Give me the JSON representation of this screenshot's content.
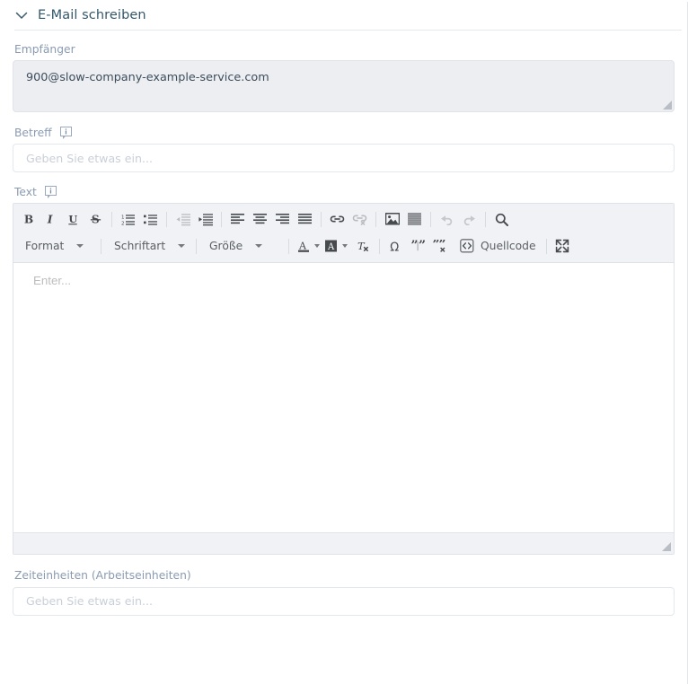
{
  "panel": {
    "title": "E-Mail schreiben",
    "collapse_icon": "chevron-down-icon"
  },
  "fields": {
    "recipient": {
      "label": "Empfänger",
      "value": "900@slow-company-example-service.com"
    },
    "subject": {
      "label": "Betreff",
      "info_icon": "info-tooltip-icon",
      "value": "",
      "placeholder": "Geben Sie etwas ein..."
    },
    "body": {
      "label": "Text",
      "info_icon": "info-tooltip-icon",
      "value": "",
      "placeholder": "Enter..."
    },
    "time_units": {
      "label": "Zeiteinheiten (Arbeitseinheiten)",
      "value": "",
      "placeholder": "Geben Sie etwas ein..."
    }
  },
  "editor_toolbar": {
    "row1": [
      {
        "name": "bold-icon",
        "title": "Fett",
        "disabled": false
      },
      {
        "name": "italic-icon",
        "title": "Kursiv",
        "disabled": false
      },
      {
        "name": "underline-icon",
        "title": "Unterstrichen",
        "disabled": false
      },
      {
        "name": "strikethrough-icon",
        "title": "Durchgestrichen",
        "disabled": false
      },
      {
        "name": "separator",
        "title": "",
        "disabled": false
      },
      {
        "name": "numbered-list-icon",
        "title": "Nummerierte Liste",
        "disabled": false
      },
      {
        "name": "bulleted-list-icon",
        "title": "Aufzählungsliste",
        "disabled": false
      },
      {
        "name": "separator",
        "title": "",
        "disabled": false
      },
      {
        "name": "outdent-icon",
        "title": "Einzug verkleinern",
        "disabled": true
      },
      {
        "name": "indent-icon",
        "title": "Einzug vergrößern",
        "disabled": false
      },
      {
        "name": "separator",
        "title": "",
        "disabled": false
      },
      {
        "name": "align-left-icon",
        "title": "Linksbündig",
        "disabled": false
      },
      {
        "name": "align-center-icon",
        "title": "Zentriert",
        "disabled": false
      },
      {
        "name": "align-right-icon",
        "title": "Rechtsbündig",
        "disabled": false
      },
      {
        "name": "align-justify-icon",
        "title": "Blocksatz",
        "disabled": false
      },
      {
        "name": "separator",
        "title": "",
        "disabled": false
      },
      {
        "name": "link-icon",
        "title": "Link einfügen",
        "disabled": false
      },
      {
        "name": "unlink-icon",
        "title": "Link entfernen",
        "disabled": true
      },
      {
        "name": "separator",
        "title": "",
        "disabled": false
      },
      {
        "name": "image-icon",
        "title": "Bild einfügen",
        "disabled": false
      },
      {
        "name": "horizontal-rule-icon",
        "title": "Horizontale Linie",
        "disabled": false
      },
      {
        "name": "separator",
        "title": "",
        "disabled": false
      },
      {
        "name": "undo-icon",
        "title": "Rückgängig",
        "disabled": true
      },
      {
        "name": "redo-icon",
        "title": "Wiederholen",
        "disabled": true
      },
      {
        "name": "separator",
        "title": "",
        "disabled": false
      },
      {
        "name": "search-icon",
        "title": "Suchen",
        "disabled": false
      }
    ],
    "combos": [
      {
        "name": "format-select",
        "label": "Format"
      },
      {
        "name": "font-select",
        "label": "Schriftart"
      },
      {
        "name": "size-select",
        "label": "Größe"
      }
    ],
    "text_color": {
      "name": "text-color-icon",
      "label": "A"
    },
    "bg_color": {
      "name": "background-color-icon",
      "label": "A"
    },
    "remove_format": {
      "name": "remove-format-icon",
      "label": "Tx"
    },
    "row2_rest": [
      {
        "name": "special-character-icon",
        "title": "Sonderzeichen",
        "disabled": false
      },
      {
        "name": "insert-quote-icon",
        "title": "Zitat einfügen",
        "disabled": false
      },
      {
        "name": "remove-quote-icon",
        "title": "Zitat entfernen",
        "disabled": false
      }
    ],
    "source": {
      "name": "source-code-button",
      "label": "Quellcode"
    },
    "maximize": {
      "name": "maximize-icon",
      "label": ""
    }
  },
  "colors": {
    "title": "#32586b",
    "label": "#8a9bb1",
    "toolbar_bg": "#f1f2f5",
    "field_border": "#e4e7eb",
    "readonly_bg": "#eceef1",
    "icon": "#474a4d",
    "placeholder": "#c9cfd8"
  }
}
